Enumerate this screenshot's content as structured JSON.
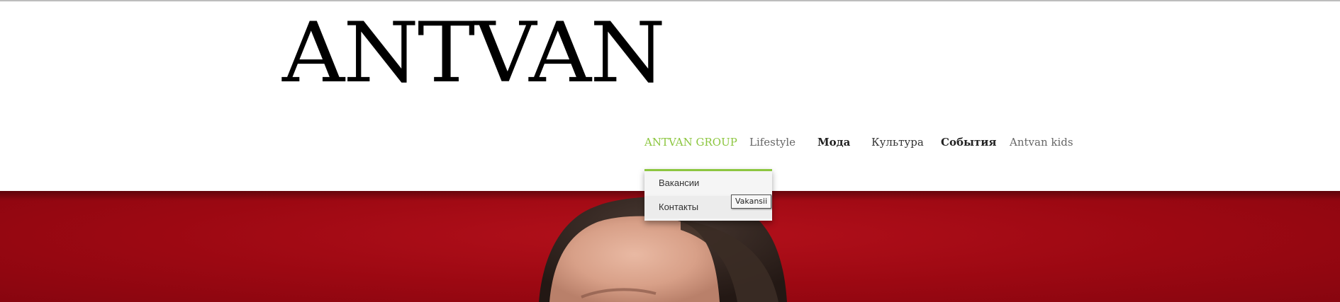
{
  "site": {
    "logo_text": "ANTVAN"
  },
  "nav": {
    "items": [
      {
        "label": "ANTVAN GROUP"
      },
      {
        "label": "Lifestyle"
      },
      {
        "label": "Мода"
      },
      {
        "label": "Культура"
      },
      {
        "label": "События"
      },
      {
        "label": "Antvan kids"
      }
    ]
  },
  "dropdown": {
    "items": [
      {
        "label": "Вакансии"
      },
      {
        "label": "Контакты"
      }
    ]
  },
  "tooltip": {
    "text": "Vakansii"
  },
  "colors": {
    "accent": "#8cc63f",
    "hero_background": "#9c0812",
    "text": "#333333"
  }
}
